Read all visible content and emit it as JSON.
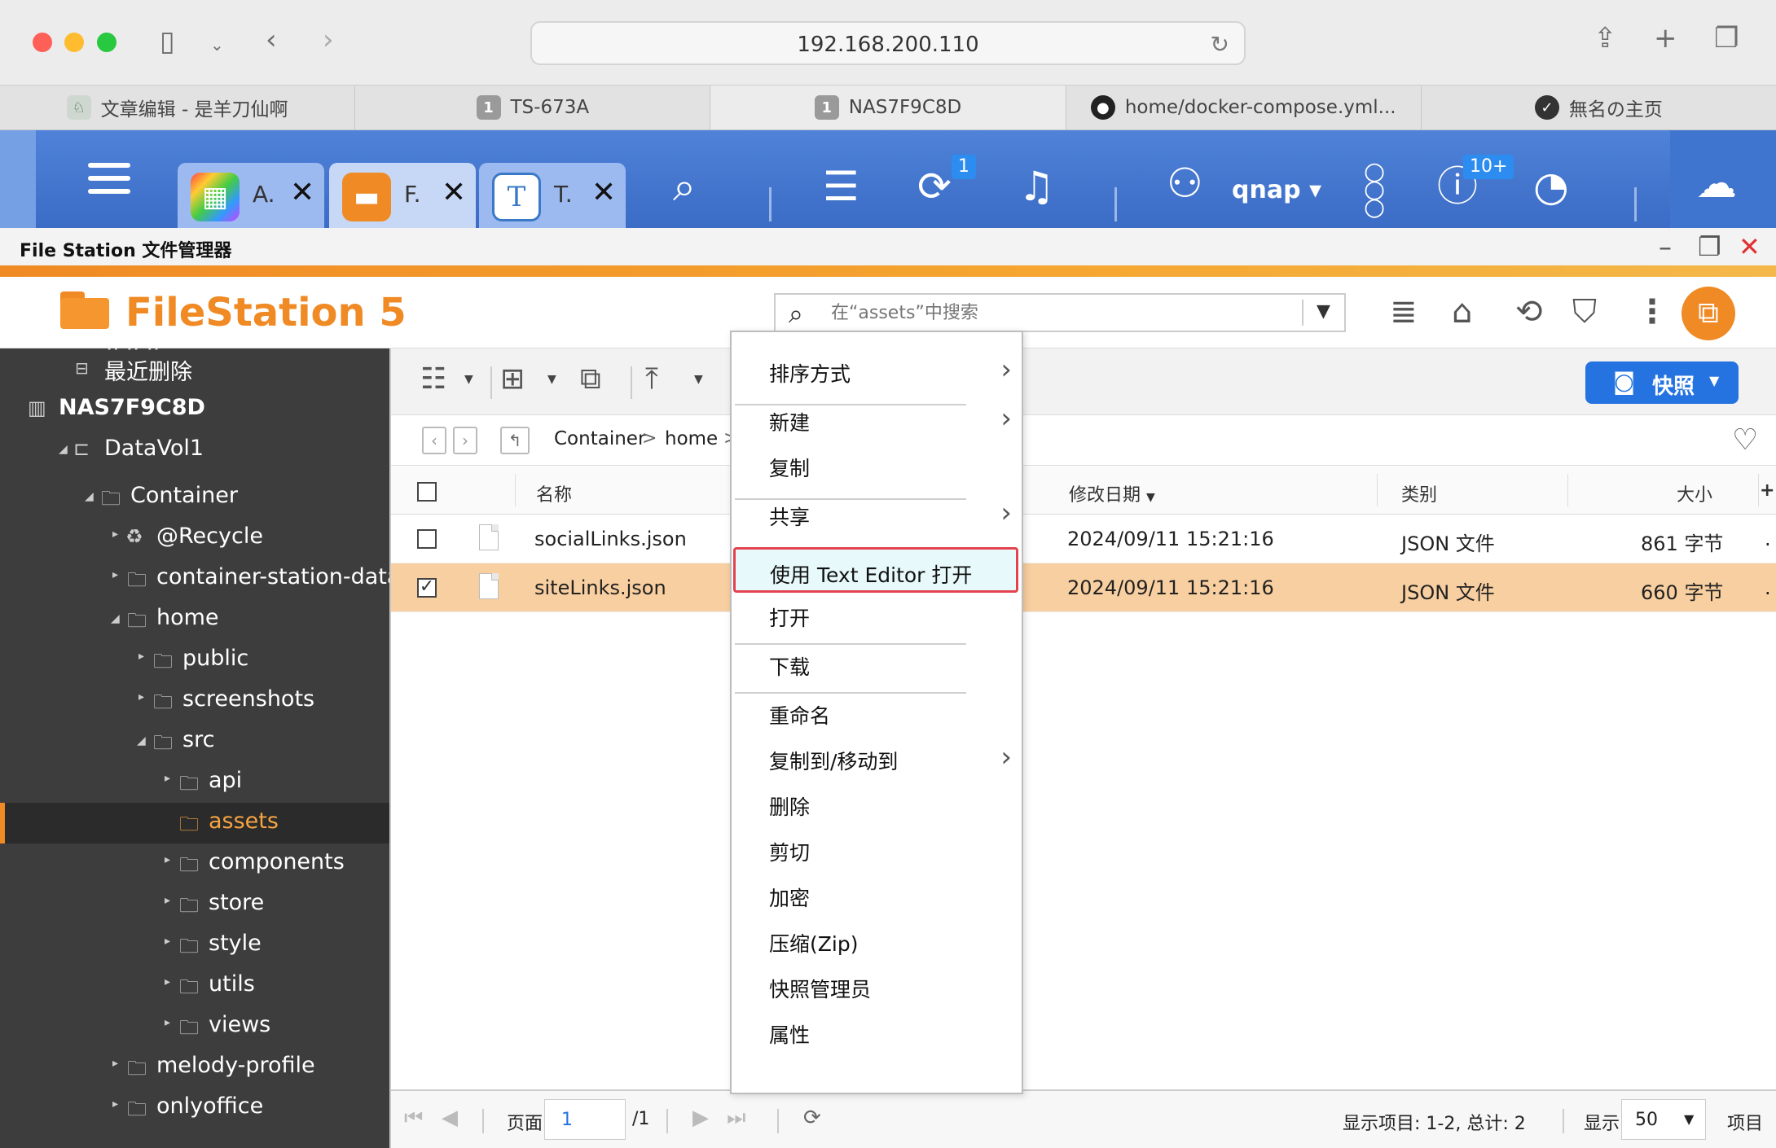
{
  "browser": {
    "url": "192.168.200.110",
    "tabs": [
      {
        "label": "文章编辑 - 是羊刀仙啊"
      },
      {
        "label": "TS-673A",
        "badge": "1"
      },
      {
        "label": "NAS7F9C8D",
        "badge": "1"
      },
      {
        "label": "home/docker-compose.yml..."
      },
      {
        "label": "無名の主页"
      }
    ]
  },
  "qts": {
    "apps": [
      {
        "label": "A."
      },
      {
        "label": "F."
      },
      {
        "label": "T."
      }
    ],
    "badges": {
      "usb": "1",
      "info": "10+"
    },
    "user": "qnap ▾"
  },
  "window": {
    "title": "File Station 文件管理器"
  },
  "header": {
    "app_name": "FileStation 5",
    "search_placeholder": "在“assets”中搜索"
  },
  "sidebar": {
    "items": [
      {
        "label": "最近删除"
      },
      {
        "label": "NAS7F9C8D"
      },
      {
        "label": "DataVol1"
      },
      {
        "label": "Container"
      },
      {
        "label": "@Recycle"
      },
      {
        "label": "container-station-data"
      },
      {
        "label": "home"
      },
      {
        "label": "public"
      },
      {
        "label": "screenshots"
      },
      {
        "label": "src"
      },
      {
        "label": "api"
      },
      {
        "label": "assets"
      },
      {
        "label": "components"
      },
      {
        "label": "store"
      },
      {
        "label": "style"
      },
      {
        "label": "utils"
      },
      {
        "label": "views"
      },
      {
        "label": "melody-profile"
      },
      {
        "label": "onlyoffice"
      }
    ]
  },
  "toolbar": {
    "snapshot_label": "快照"
  },
  "breadcrumb": [
    "Container",
    "home"
  ],
  "table": {
    "headers": {
      "name": "名称",
      "modified": "修改日期",
      "type": "类别",
      "size": "大小"
    },
    "rows": [
      {
        "name": "socialLinks.json",
        "modified": "2024/09/11 15:21:16",
        "type": "JSON 文件",
        "size": "861 字节",
        "checked": false
      },
      {
        "name": "siteLinks.json",
        "modified": "2024/09/11 15:21:16",
        "type": "JSON 文件",
        "size": "660 字节",
        "checked": true
      }
    ]
  },
  "context_menu": {
    "items": [
      {
        "label": "排序方式"
      },
      {
        "label": "新建"
      },
      {
        "label": "复制"
      },
      {
        "label": "共享"
      },
      {
        "label": "使用 Text Editor 打开"
      },
      {
        "label": "打开"
      },
      {
        "label": "下载"
      },
      {
        "label": "重命名"
      },
      {
        "label": "复制到/移动到"
      },
      {
        "label": "删除"
      },
      {
        "label": "剪切"
      },
      {
        "label": "加密"
      },
      {
        "label": "压缩(Zip)"
      },
      {
        "label": "快照管理员"
      },
      {
        "label": "属性"
      }
    ]
  },
  "pager": {
    "page_label": "页面",
    "page_value": "1",
    "total_pages": "/1",
    "display_info": "显示项目:  1-2, 总计:  2",
    "show_label": "显示",
    "per_page": "50",
    "items_label": "项目"
  },
  "colors": {
    "accent_orange": "#f08a24",
    "qts_blue": "#3b6cc6",
    "selected_row": "#f8cfa0",
    "highlight_border": "#e2434f"
  }
}
